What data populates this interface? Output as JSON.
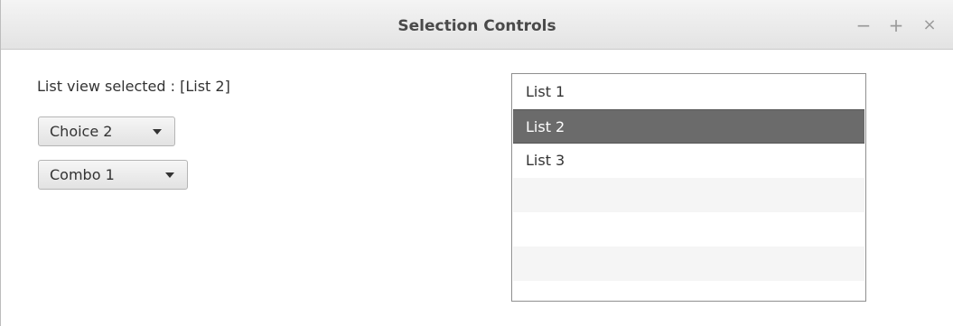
{
  "window": {
    "title": "Selection Controls",
    "controls": {
      "minimize": "−",
      "maximize": "+",
      "close": "×"
    }
  },
  "content": {
    "status_label": "List view selected : [List 2]",
    "choice_box": {
      "selected": "Choice 2"
    },
    "combo_box": {
      "selected": "Combo 1"
    },
    "list_view": {
      "items": [
        "List 1",
        "List 2",
        "List 3"
      ],
      "selected_item": "List 2"
    }
  }
}
